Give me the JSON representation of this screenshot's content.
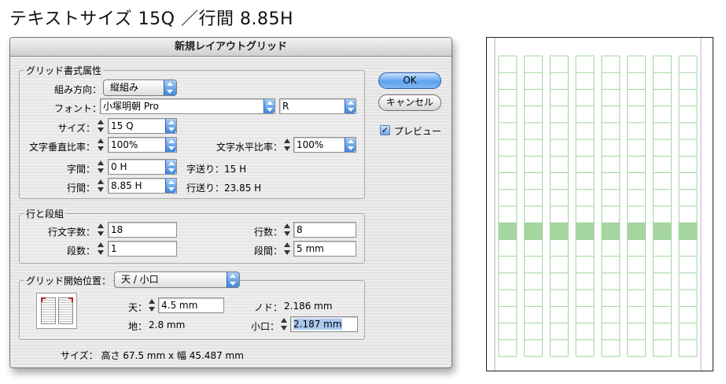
{
  "headline": "テキストサイズ 15Q ／行間 8.85H",
  "dialog": {
    "title": "新規レイアウトグリッド",
    "buttons": {
      "ok": "OK",
      "cancel": "キャンセル"
    },
    "preview": {
      "label": "プレビュー",
      "checked": true,
      "check_glyph": "✓"
    },
    "grid_attrs": {
      "legend": "グリッド書式属性",
      "direction_label": "組み方向：",
      "direction_value": "縦組み",
      "font_label": "フォント：",
      "font_value": "小塚明朝 Pro",
      "font_style_value": "R",
      "size_label": "サイズ：",
      "size_value": "15 Q",
      "vscale_label": "文字垂直比率：",
      "vscale_value": "100%",
      "hscale_label": "文字水平比率：",
      "hscale_value": "100%",
      "char_space_label": "字間：",
      "char_space_value": "0 H",
      "char_pitch_text": "字送り：15 H",
      "line_space_label": "行間：",
      "line_space_value": "8.85 H",
      "line_pitch_text": "行送り：23.85 H"
    },
    "lines_columns": {
      "legend": "行と段組",
      "chars_per_line_label": "行文字数：",
      "chars_per_line_value": "18",
      "lines_label": "行数：",
      "lines_value": "8",
      "columns_label": "段数：",
      "columns_value": "1",
      "gutter_label": "段間：",
      "gutter_value": "5 mm"
    },
    "start_position": {
      "legend": "グリッド開始位置：",
      "value": "天 / 小口",
      "top_label": "天：",
      "top_value": "4.5 mm",
      "bottom_label": "地：",
      "bottom_value": "2.8 mm",
      "gutter_side_label": "ノド：",
      "gutter_side_value": "2.186 mm",
      "fore_edge_label": "小口：",
      "fore_edge_value": "2.187 mm"
    },
    "size_summary": "サイズ：  高さ 67.5 mm x 幅 45.487 mm"
  },
  "grid_preview": {
    "columns": 8,
    "cells_per_column": 18,
    "highlight_row": 10,
    "line_color": "#9fd49a",
    "cell_fill": "#a6d6a0",
    "margin_color": "#c9a0d2"
  }
}
